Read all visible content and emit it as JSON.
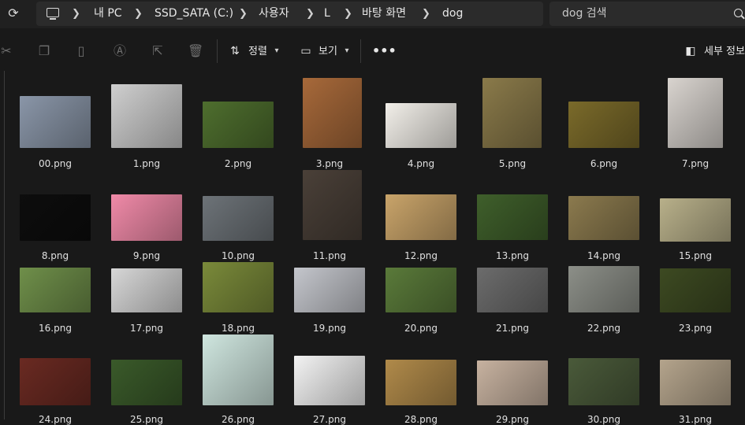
{
  "address": {
    "crumbs": [
      "내 PC",
      "SSD_SATA (C:)",
      "사용자",
      "L",
      "바탕 화면",
      "dog"
    ]
  },
  "search": {
    "placeholder": "dog 검색"
  },
  "toolbar": {
    "sort_label": "정렬",
    "view_label": "보기",
    "details_label": "세부 정보"
  },
  "files": [
    {
      "name": "00.png",
      "color": "#8a96a8"
    },
    {
      "name": "1.png",
      "color": "#cfcfcf"
    },
    {
      "name": "2.png",
      "color": "#4e6e2e"
    },
    {
      "name": "3.png",
      "color": "#a7693a"
    },
    {
      "name": "4.png",
      "color": "#f2efe9"
    },
    {
      "name": "5.png",
      "color": "#8a7a4a"
    },
    {
      "name": "6.png",
      "color": "#7a6a2a"
    },
    {
      "name": "7.png",
      "color": "#d9d4cf"
    },
    {
      "name": "8.png",
      "color": "#0d0d0d"
    },
    {
      "name": "9.png",
      "color": "#f08aa8"
    },
    {
      "name": "10.png",
      "color": "#6d7378"
    },
    {
      "name": "11.png",
      "color": "#4a4038"
    },
    {
      "name": "12.png",
      "color": "#c9a46a"
    },
    {
      "name": "13.png",
      "color": "#3f5f2b"
    },
    {
      "name": "14.png",
      "color": "#8b7a4e"
    },
    {
      "name": "15.png",
      "color": "#b8b08a"
    },
    {
      "name": "16.png",
      "color": "#6f8f4a"
    },
    {
      "name": "17.png",
      "color": "#d7d7d7"
    },
    {
      "name": "18.png",
      "color": "#7a8a3a"
    },
    {
      "name": "19.png",
      "color": "#c4c6cc"
    },
    {
      "name": "20.png",
      "color": "#5a7a3a"
    },
    {
      "name": "21.png",
      "color": "#6c6c6c"
    },
    {
      "name": "22.png",
      "color": "#8c8f88"
    },
    {
      "name": "23.png",
      "color": "#3d4a22"
    },
    {
      "name": "24.png",
      "color": "#6a2a22"
    },
    {
      "name": "25.png",
      "color": "#3a5a2a"
    },
    {
      "name": "26.png",
      "color": "#cfe6df"
    },
    {
      "name": "27.png",
      "color": "#f3f3f3"
    },
    {
      "name": "28.png",
      "color": "#b08a4a"
    },
    {
      "name": "29.png",
      "color": "#c7b2a0"
    },
    {
      "name": "30.png",
      "color": "#4a5a3a"
    },
    {
      "name": "31.png",
      "color": "#b4a48c"
    }
  ]
}
